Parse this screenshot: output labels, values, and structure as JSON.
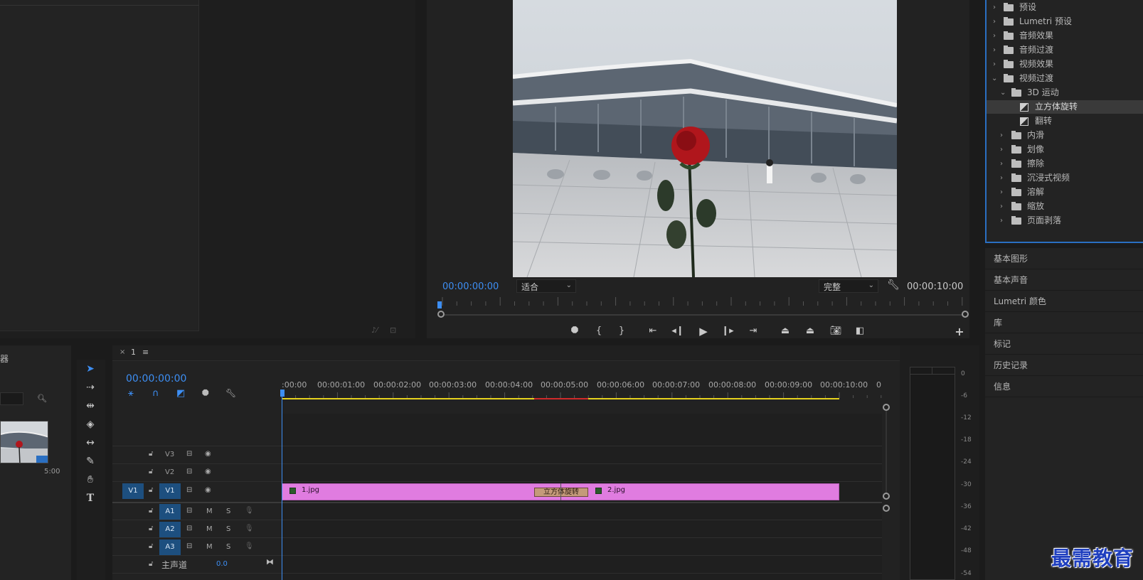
{
  "program_monitor": {
    "timecode_current": "00:00:00:00",
    "fit_dropdown": "适合",
    "quality_dropdown": "完整",
    "timecode_duration": "00:00:10:00"
  },
  "effects_panel": {
    "items": [
      {
        "label": "预设"
      },
      {
        "label": "Lumetri 预设"
      },
      {
        "label": "音频效果"
      },
      {
        "label": "音频过渡"
      },
      {
        "label": "视频效果"
      },
      {
        "label": "视频过渡"
      },
      {
        "label": "3D 运动"
      },
      {
        "label": "立方体旋转"
      },
      {
        "label": "翻转"
      },
      {
        "label": "内滑"
      },
      {
        "label": "划像"
      },
      {
        "label": "擦除"
      },
      {
        "label": "沉浸式视频"
      },
      {
        "label": "溶解"
      },
      {
        "label": "缩放"
      },
      {
        "label": "页面剥落"
      }
    ]
  },
  "side_panels": [
    "基本图形",
    "基本声音",
    "Lumetri 颜色",
    "库",
    "标记",
    "历史记录",
    "信息"
  ],
  "project_bottom": {
    "header_fragment": "器",
    "thumb_duration": "5:00"
  },
  "timeline": {
    "sequence_name": "1",
    "timecode": "00:00:00:00",
    "ruler_labels": [
      ":00:00",
      "00:00:01:00",
      "00:00:02:00",
      "00:00:03:00",
      "00:00:04:00",
      "00:00:05:00",
      "00:00:06:00",
      "00:00:07:00",
      "00:00:08:00",
      "00:00:09:00",
      "00:00:10:00",
      "0"
    ],
    "video_tracks": [
      "V3",
      "V2",
      "V1"
    ],
    "source_patch": "V1",
    "audio_tracks": [
      "A1",
      "A2",
      "A3"
    ],
    "mute_label": "M",
    "solo_label": "S",
    "master_label": "主声道",
    "master_value": "0.0",
    "clip1_name": "1.jpg",
    "clip2_name": "2.jpg",
    "transition_name": "立方体旋转"
  },
  "audio_meter": {
    "scale": [
      "0",
      "-6",
      "-12",
      "-18",
      "-24",
      "-30",
      "-36",
      "-42",
      "-48",
      "-54"
    ]
  },
  "watermark": "最需教育",
  "colors": {
    "accent_blue": "#3d8ef3",
    "clip_pink": "#e07ce0",
    "workarea_yellow": "#e6d21e",
    "render_red": "#d02a2a"
  }
}
